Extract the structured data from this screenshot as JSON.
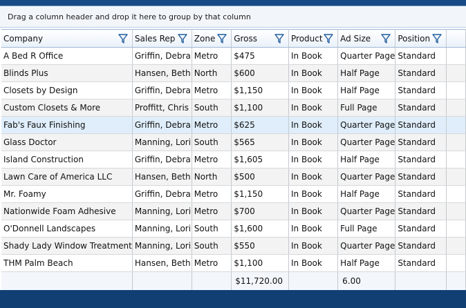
{
  "group_by_hint": "Drag a column header and drop it here to group by that column",
  "columns": [
    {
      "label": "Company"
    },
    {
      "label": "Sales Rep"
    },
    {
      "label": "Zone"
    },
    {
      "label": "Gross"
    },
    {
      "label": "Product"
    },
    {
      "label": "Ad Size"
    },
    {
      "label": "Position"
    }
  ],
  "rows": [
    [
      "A Bed R Office",
      "Griffin, Debra",
      "Metro",
      "$475",
      "In Book",
      "Quarter Page",
      "Standard"
    ],
    [
      "Blinds Plus",
      "Hansen, Beth",
      "North",
      "$600",
      "In Book",
      "Half Page",
      "Standard"
    ],
    [
      "Closets by Design",
      "Griffin, Debra",
      "Metro",
      "$1,150",
      "In Book",
      "Half Page",
      "Standard"
    ],
    [
      "Custom Closets & More",
      "Proffitt, Chris",
      "South",
      "$1,100",
      "In Book",
      "Full Page",
      "Standard"
    ],
    [
      "Fab's Faux Finishing",
      "Griffin, Debra",
      "Metro",
      "$625",
      "In Book",
      "Quarter Page",
      "Standard"
    ],
    [
      "Glass Doctor",
      "Manning, Lori",
      "South",
      "$565",
      "In Book",
      "Quarter Page",
      "Standard"
    ],
    [
      "Island Construction",
      "Griffin, Debra",
      "Metro",
      "$1,605",
      "In Book",
      "Half Page",
      "Standard"
    ],
    [
      "Lawn Care of America LLC",
      "Hansen, Beth",
      "North",
      "$500",
      "In Book",
      "Quarter Page",
      "Standard"
    ],
    [
      "Mr. Foamy",
      "Griffin, Debra",
      "Metro",
      "$1,150",
      "In Book",
      "Half Page",
      "Standard"
    ],
    [
      "Nationwide Foam Adhesive",
      "Manning, Lori",
      "Metro",
      "$700",
      "In Book",
      "Quarter Page",
      "Standard"
    ],
    [
      "O'Donnell Landscapes",
      "Manning, Lori",
      "South",
      "$1,600",
      "In Book",
      "Full Page",
      "Standard"
    ],
    [
      "Shady Lady Window Treatment",
      "Manning, Lori",
      "South",
      "$550",
      "In Book",
      "Quarter Page",
      "Standard"
    ],
    [
      "THM Palm Beach",
      "Hansen, Beth",
      "Metro",
      "$1,100",
      "In Book",
      "Half Page",
      "Standard"
    ]
  ],
  "footer": {
    "gross_total": "$11,720.00",
    "ad_size_aggregate": "6.00"
  }
}
